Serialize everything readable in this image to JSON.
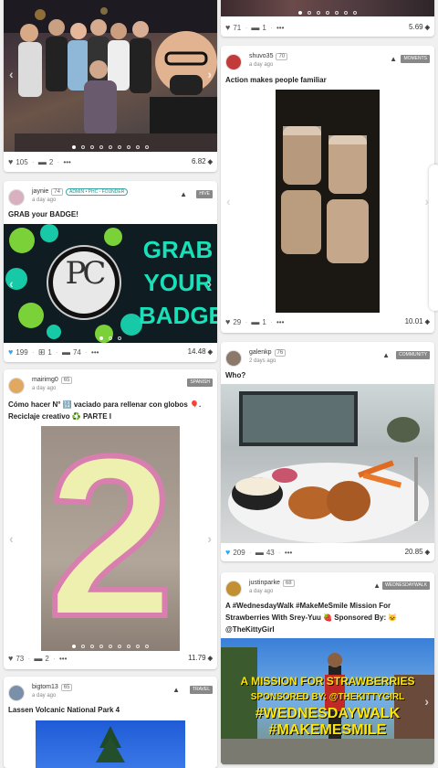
{
  "left_column": {
    "card_photo_group": {
      "votes": "105",
      "comments": "2",
      "more": "•••",
      "payout": "6.82"
    },
    "card_badge": {
      "username": "jaynie",
      "reputation": "74",
      "role": "ADMIN • PHC - FOUNDER",
      "time": "a day ago",
      "community": "HIVE",
      "title": "GRAB your BADGE!",
      "image_text": [
        "GRAB",
        "YOUR",
        "BADGE"
      ],
      "logo_text": "PC",
      "votes": "199",
      "gifts": "1",
      "comments": "74",
      "more": "•••",
      "payout": "14.48"
    },
    "card_spanish": {
      "username": "mairimg0",
      "reputation": "65",
      "time": "a day ago",
      "community": "SPANISH",
      "title": "Cómo hacer N° 🔢 vaciado para rellenar con globos 🎈. Reciclaje creativo ♻️ PARTE I",
      "image_number": "2",
      "votes": "73",
      "comments": "2",
      "more": "•••",
      "payout": "11.79"
    },
    "card_lassen": {
      "username": "bigtom13",
      "reputation": "65",
      "time": "a day ago",
      "community": "TRAVEL",
      "title": "Lassen Volcanic National Park 4"
    }
  },
  "right_column": {
    "card_top": {
      "votes": "71",
      "comments": "1",
      "more": "•••",
      "payout": "5.69"
    },
    "card_moments": {
      "username": "shuvo35",
      "reputation": "70",
      "time": "a day ago",
      "community": "MOMENTS",
      "title": "Action makes people familiar",
      "votes": "29",
      "comments": "1",
      "more": "•••",
      "payout": "10.01"
    },
    "card_who": {
      "username": "galenkp",
      "reputation": "76",
      "time": "2 days ago",
      "community": "COMMUNITY",
      "title": "Who?",
      "votes": "209",
      "comments": "43",
      "more": "•••",
      "payout": "20.85"
    },
    "card_walk": {
      "username": "justinparke",
      "reputation": "68",
      "time": "a day ago",
      "community": "WEDNESDAYWALK",
      "title": "A #WednesdayWalk #MakeMeSmile Mission For Strawberries With Srey-Yuu 🍓 Sponsored By: 🐱 @TheKittyGirl",
      "image_text": [
        "A MISSION FOR STRAWBERRIES",
        "SPONSORED BY: @THEKITTYGIRL",
        "#WEDNESDAYWALK",
        "#MAKEMESMILE"
      ]
    }
  },
  "icons": {
    "vote": "heart-icon",
    "comment": "comment-icon",
    "gift": "gift-icon",
    "payout": "hive-icon",
    "prev": "chevron-left-icon",
    "next": "chevron-right-icon",
    "community": "hive-logo-icon"
  },
  "colors": {
    "accent_teal": "#2b8a8a",
    "liked_blue": "#35a3e8",
    "badge_green": "#18c9a7",
    "banner_yellow": "#ffe600"
  }
}
